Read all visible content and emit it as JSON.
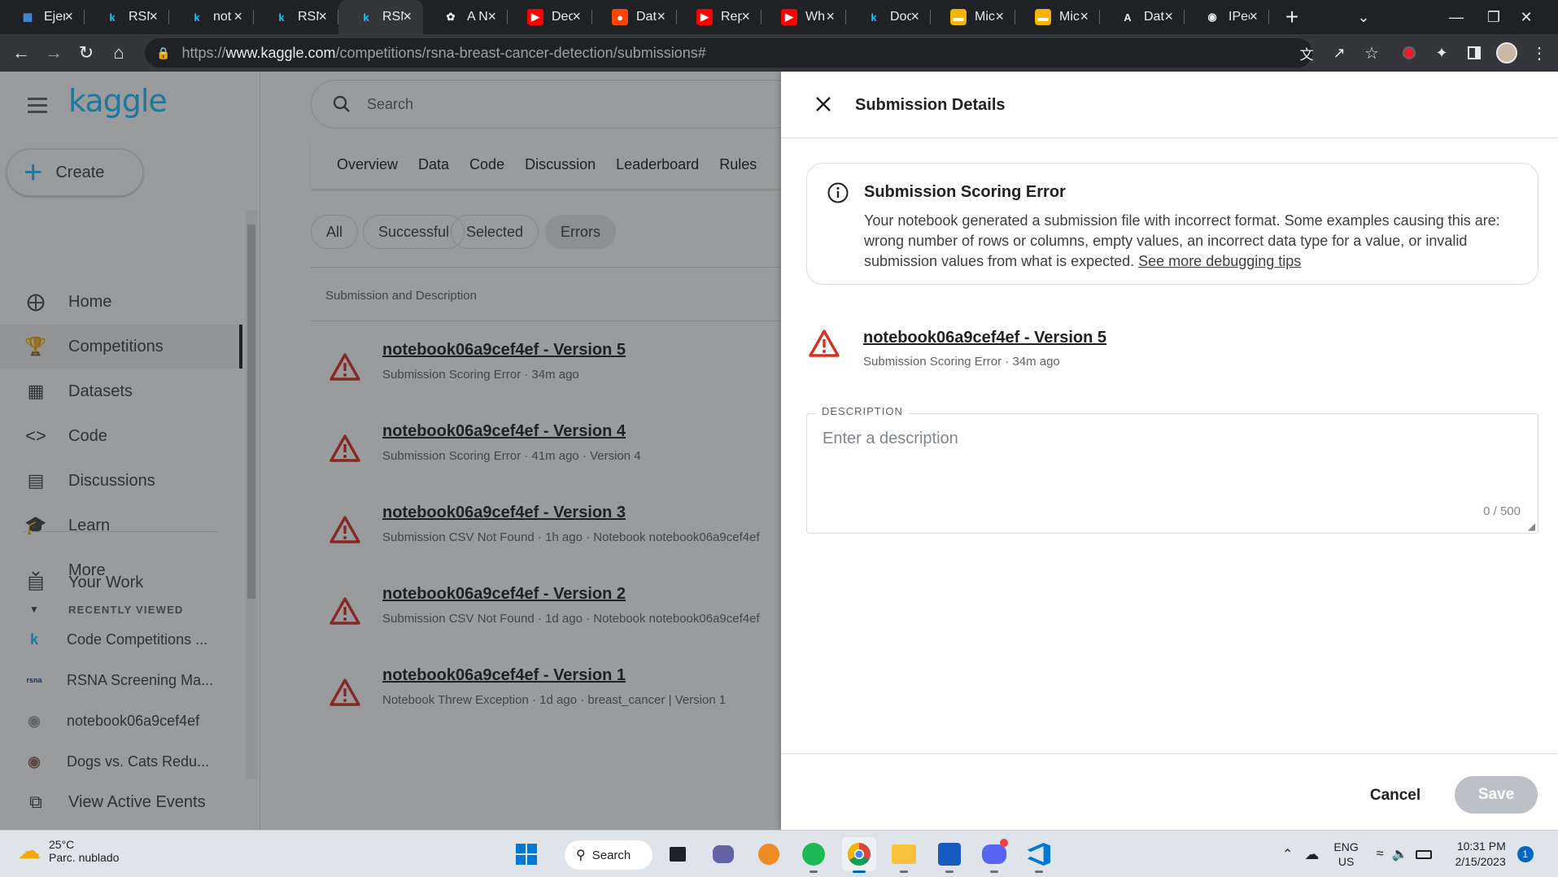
{
  "browser": {
    "tabs": [
      {
        "title": "Ejer",
        "favicon": "doc-icon",
        "color": "#4a90d9"
      },
      {
        "title": "RSN",
        "favicon": "kaggle-icon",
        "color": "#20beff"
      },
      {
        "title": "not",
        "favicon": "kaggle-icon",
        "color": "#20beff"
      },
      {
        "title": "RSN",
        "favicon": "kaggle-icon",
        "color": "#20beff"
      },
      {
        "title": "RSN",
        "favicon": "kaggle-icon",
        "color": "#20beff",
        "active": true
      },
      {
        "title": "A N",
        "favicon": "openai-icon",
        "color": "#e8eaed"
      },
      {
        "title": "Dec",
        "favicon": "youtube-icon",
        "color": "#ff0000"
      },
      {
        "title": "Dat",
        "favicon": "reddit-icon",
        "color": "#ff4500"
      },
      {
        "title": "Rep",
        "favicon": "youtube-icon",
        "color": "#ff0000"
      },
      {
        "title": "Wh",
        "favicon": "youtube-icon",
        "color": "#ff0000"
      },
      {
        "title": "Doc",
        "favicon": "kaggle-icon",
        "color": "#20beff"
      },
      {
        "title": "Mic",
        "favicon": "slides-icon",
        "color": "#f4b400"
      },
      {
        "title": "Mic",
        "favicon": "slides-icon",
        "color": "#f4b400"
      },
      {
        "title": "Dat",
        "favicon": "a-icon",
        "color": "#e8eaed"
      },
      {
        "title": "IPec",
        "favicon": "github-icon",
        "color": "#e8eaed"
      }
    ],
    "url_prefix": "https://",
    "url_domain": "www.kaggle.com",
    "url_path": "/competitions/rsna-breast-cancer-detection/submissions#"
  },
  "sidebar": {
    "logo": "kaggle",
    "create_label": "Create",
    "items": [
      {
        "label": "Home",
        "icon": "compass-icon"
      },
      {
        "label": "Competitions",
        "icon": "trophy-icon",
        "selected": true
      },
      {
        "label": "Datasets",
        "icon": "table-icon"
      },
      {
        "label": "Code",
        "icon": "code-icon"
      },
      {
        "label": "Discussions",
        "icon": "chat-icon"
      },
      {
        "label": "Learn",
        "icon": "school-icon"
      },
      {
        "label": "More",
        "icon": "chevron-down-icon"
      }
    ],
    "your_work": "Your Work",
    "recently_viewed_title": "RECENTLY VIEWED",
    "recent": [
      {
        "label": "Code Competitions ...",
        "icon": "kaggle-k-icon"
      },
      {
        "label": "RSNA Screening Ma...",
        "icon": "rsna-icon"
      },
      {
        "label": "notebook06a9cef4ef",
        "icon": "notebook-avatar-icon"
      },
      {
        "label": "Dogs vs. Cats Redu...",
        "icon": "cat-icon"
      }
    ],
    "view_active_events": "View Active Events"
  },
  "main": {
    "search_placeholder": "Search",
    "tabs": [
      "Overview",
      "Data",
      "Code",
      "Discussion",
      "Leaderboard",
      "Rules"
    ],
    "filters": [
      "All",
      "Successful",
      "Selected",
      "Errors"
    ],
    "active_filter": "Errors",
    "column_title": "Submission and Description",
    "submissions": [
      {
        "name": "notebook06a9cef4ef - Version 5",
        "meta": "Submission Scoring Error · 34m ago"
      },
      {
        "name": "notebook06a9cef4ef - Version 4",
        "meta": "Submission Scoring Error · 41m ago · Version 4"
      },
      {
        "name": "notebook06a9cef4ef - Version 3",
        "meta": "Submission CSV Not Found · 1h ago · Notebook notebook06a9cef4ef"
      },
      {
        "name": "notebook06a9cef4ef - Version 2",
        "meta": "Submission CSV Not Found · 1d ago · Notebook notebook06a9cef4ef"
      },
      {
        "name": "notebook06a9cef4ef - Version 1",
        "meta": "Notebook Threw Exception · 1d ago · breast_cancer | Version 1"
      }
    ]
  },
  "panel": {
    "title": "Submission Details",
    "error_title": "Submission Scoring Error",
    "error_body": "Your notebook generated a submission file with incorrect format. Some examples causing this are: wrong number of rows or columns, empty values, an incorrect data type for a value, or invalid submission values from what is expected. ",
    "error_link": "See more debugging tips",
    "submission_name": "notebook06a9cef4ef - Version 5",
    "submission_meta": "Submission Scoring Error · 34m ago",
    "description_label": "DESCRIPTION",
    "description_placeholder": "Enter a description",
    "char_count": "0 / 500",
    "cancel_label": "Cancel",
    "save_label": "Save"
  },
  "taskbar": {
    "temperature": "25°C",
    "weather": "Parc. nublado",
    "search_label": "Search",
    "lang": "ENG",
    "region": "US",
    "time": "10:31 PM",
    "date": "2/15/2023",
    "notif_count": "1"
  },
  "colors": {
    "kaggle_blue": "#20beff",
    "warning_red": "#d93025",
    "save_disabled": "#bdc1c6"
  }
}
